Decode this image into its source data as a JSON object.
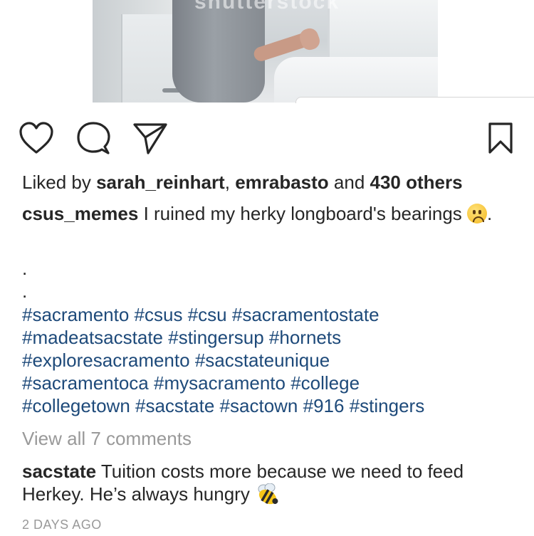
{
  "photo": {
    "watermark": "shutterstock"
  },
  "actions": {
    "like_icon": "heart-icon",
    "comment_icon": "comment-icon",
    "share_icon": "paper-plane-icon",
    "save_icon": "bookmark-icon"
  },
  "likes": {
    "prefix": "Liked by ",
    "user1": "sarah_reinhart",
    "separator": ", ",
    "user2": "emrabasto",
    "and": " and ",
    "others": "430 others"
  },
  "caption": {
    "username": "csus_memes",
    "text": " I ruined my herky longboard's bearings ",
    "emoji": "frowning-face",
    "trailing": ".",
    "dots": [
      ".",
      "."
    ]
  },
  "hashtags": [
    [
      "#sacramento",
      "#csus",
      "#csu",
      "#sacramentostate"
    ],
    [
      "#madeatsacstate",
      "#stingersup",
      "#hornets"
    ],
    [
      "#exploresacramento",
      "#sacstateunique"
    ],
    [
      "#sacramentoca",
      "#mysacramento",
      "#college"
    ],
    [
      "#collegetown",
      "#sacstate",
      "#sactown",
      "#916",
      "#stingers"
    ]
  ],
  "view_all_comments": "View all 7 comments",
  "comment": {
    "username": "sacstate",
    "text": " Tuition costs more because we need to feed Herkey. He’s always hungry ",
    "emoji": "honeybee"
  },
  "timestamp": "2 DAYS AGO",
  "colors": {
    "text": "#262626",
    "hashtag": "#1e4a7a",
    "muted": "#999999"
  }
}
